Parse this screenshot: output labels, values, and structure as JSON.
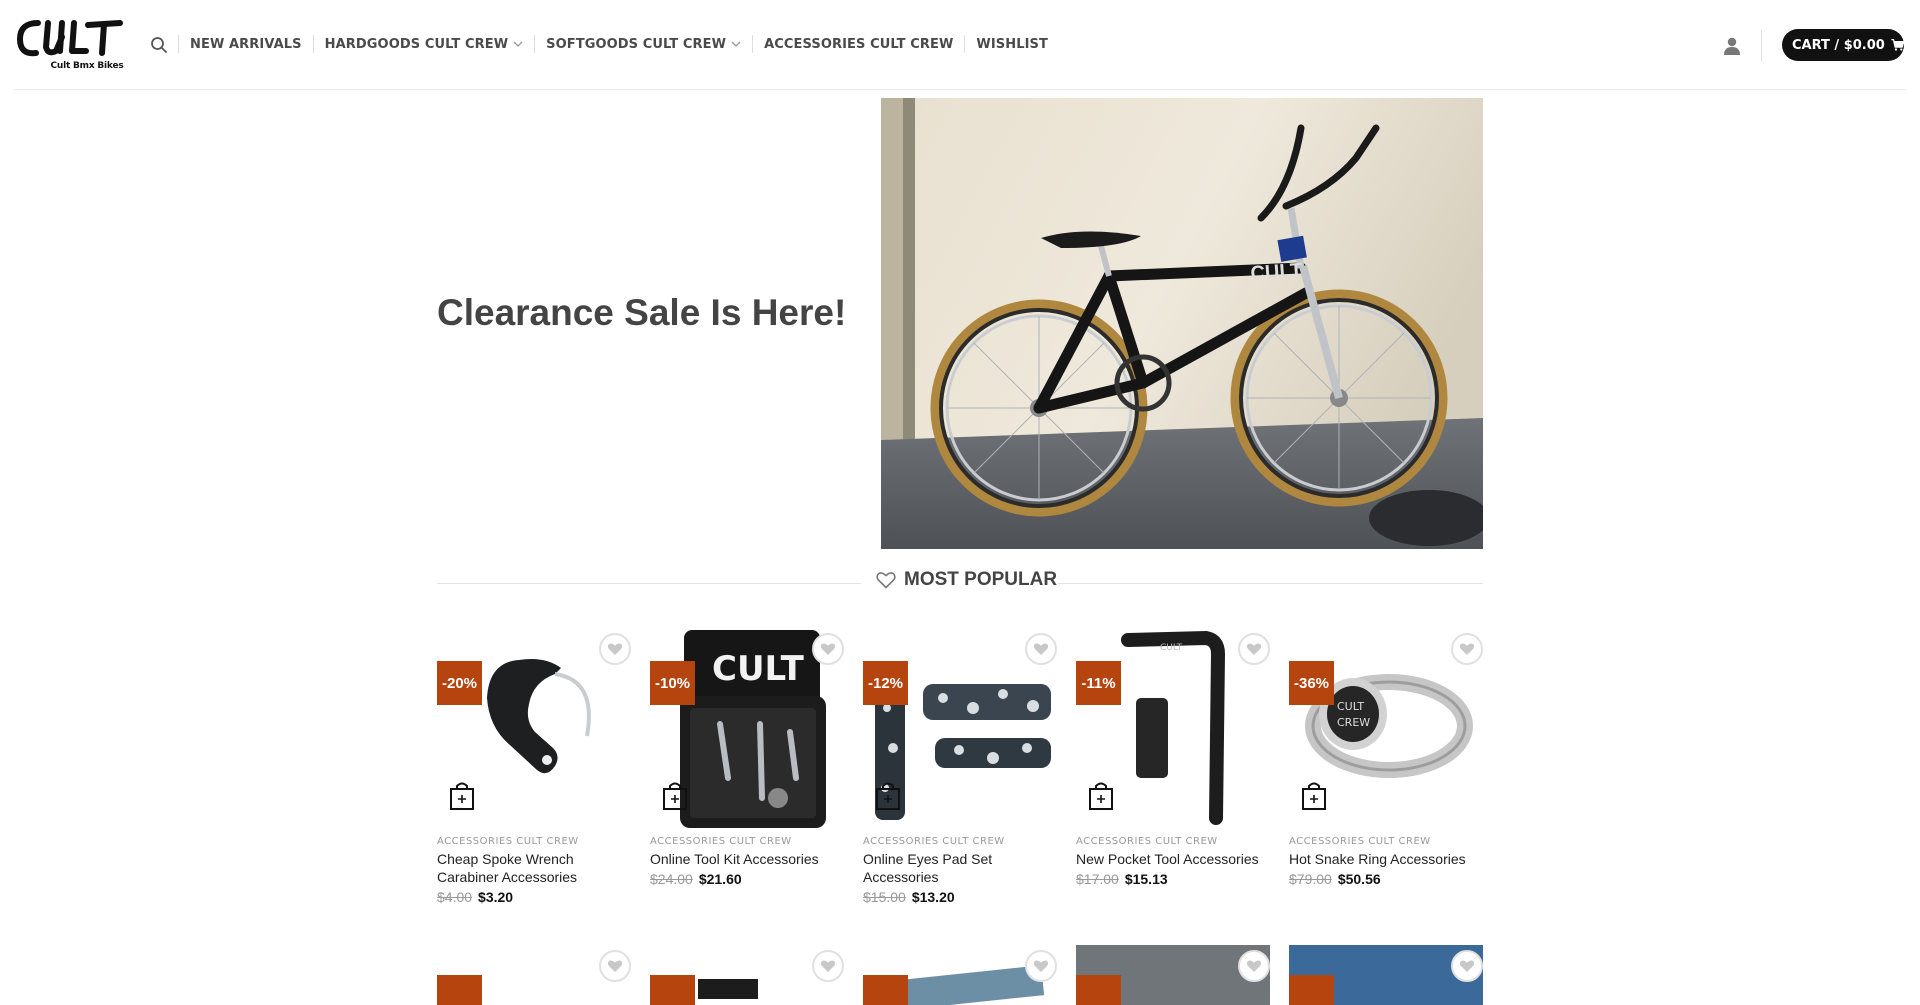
{
  "brand": {
    "logo_text": "CULT",
    "tagline": "Cult Bmx Bikes"
  },
  "nav": [
    {
      "label": "NEW ARRIVALS",
      "dropdown": false
    },
    {
      "label": "HARDGOODS CULT CREW",
      "dropdown": true
    },
    {
      "label": "SOFTGOODS CULT CREW",
      "dropdown": true
    },
    {
      "label": "ACCESSORIES CULT CREW",
      "dropdown": false
    },
    {
      "label": "WISHLIST",
      "dropdown": false
    }
  ],
  "cart": {
    "label": "CART / $0.00"
  },
  "hero": {
    "title": "Clearance Sale Is Here!"
  },
  "section": {
    "title": "MOST POPULAR"
  },
  "colors": {
    "badge": "#b6440f",
    "cart_bg": "#111111"
  },
  "products": [
    {
      "badge": "-20%",
      "category": "ACCESSORIES CULT CREW",
      "name": "Cheap Spoke Wrench Carabiner Accessories",
      "old_price": "$4.00",
      "price": "$3.20",
      "icon": "carabiner-wrench-image"
    },
    {
      "badge": "-10%",
      "category": "ACCESSORIES CULT CREW",
      "name": "Online Tool Kit Accessories",
      "old_price": "$24.00",
      "price": "$21.60",
      "icon": "tool-kit-image"
    },
    {
      "badge": "-12%",
      "category": "ACCESSORIES CULT CREW",
      "name": "Online Eyes Pad Set Accessories",
      "old_price": "$15.00",
      "price": "$13.20",
      "icon": "pad-set-image"
    },
    {
      "badge": "-11%",
      "category": "ACCESSORIES CULT CREW",
      "name": "New Pocket Tool Accessories",
      "old_price": "$17.00",
      "price": "$15.13",
      "icon": "pocket-tool-image"
    },
    {
      "badge": "-36%",
      "category": "ACCESSORIES CULT CREW",
      "name": "Hot Snake Ring Accessories",
      "old_price": "$79.00",
      "price": "$50.56",
      "icon": "ring-image"
    }
  ]
}
